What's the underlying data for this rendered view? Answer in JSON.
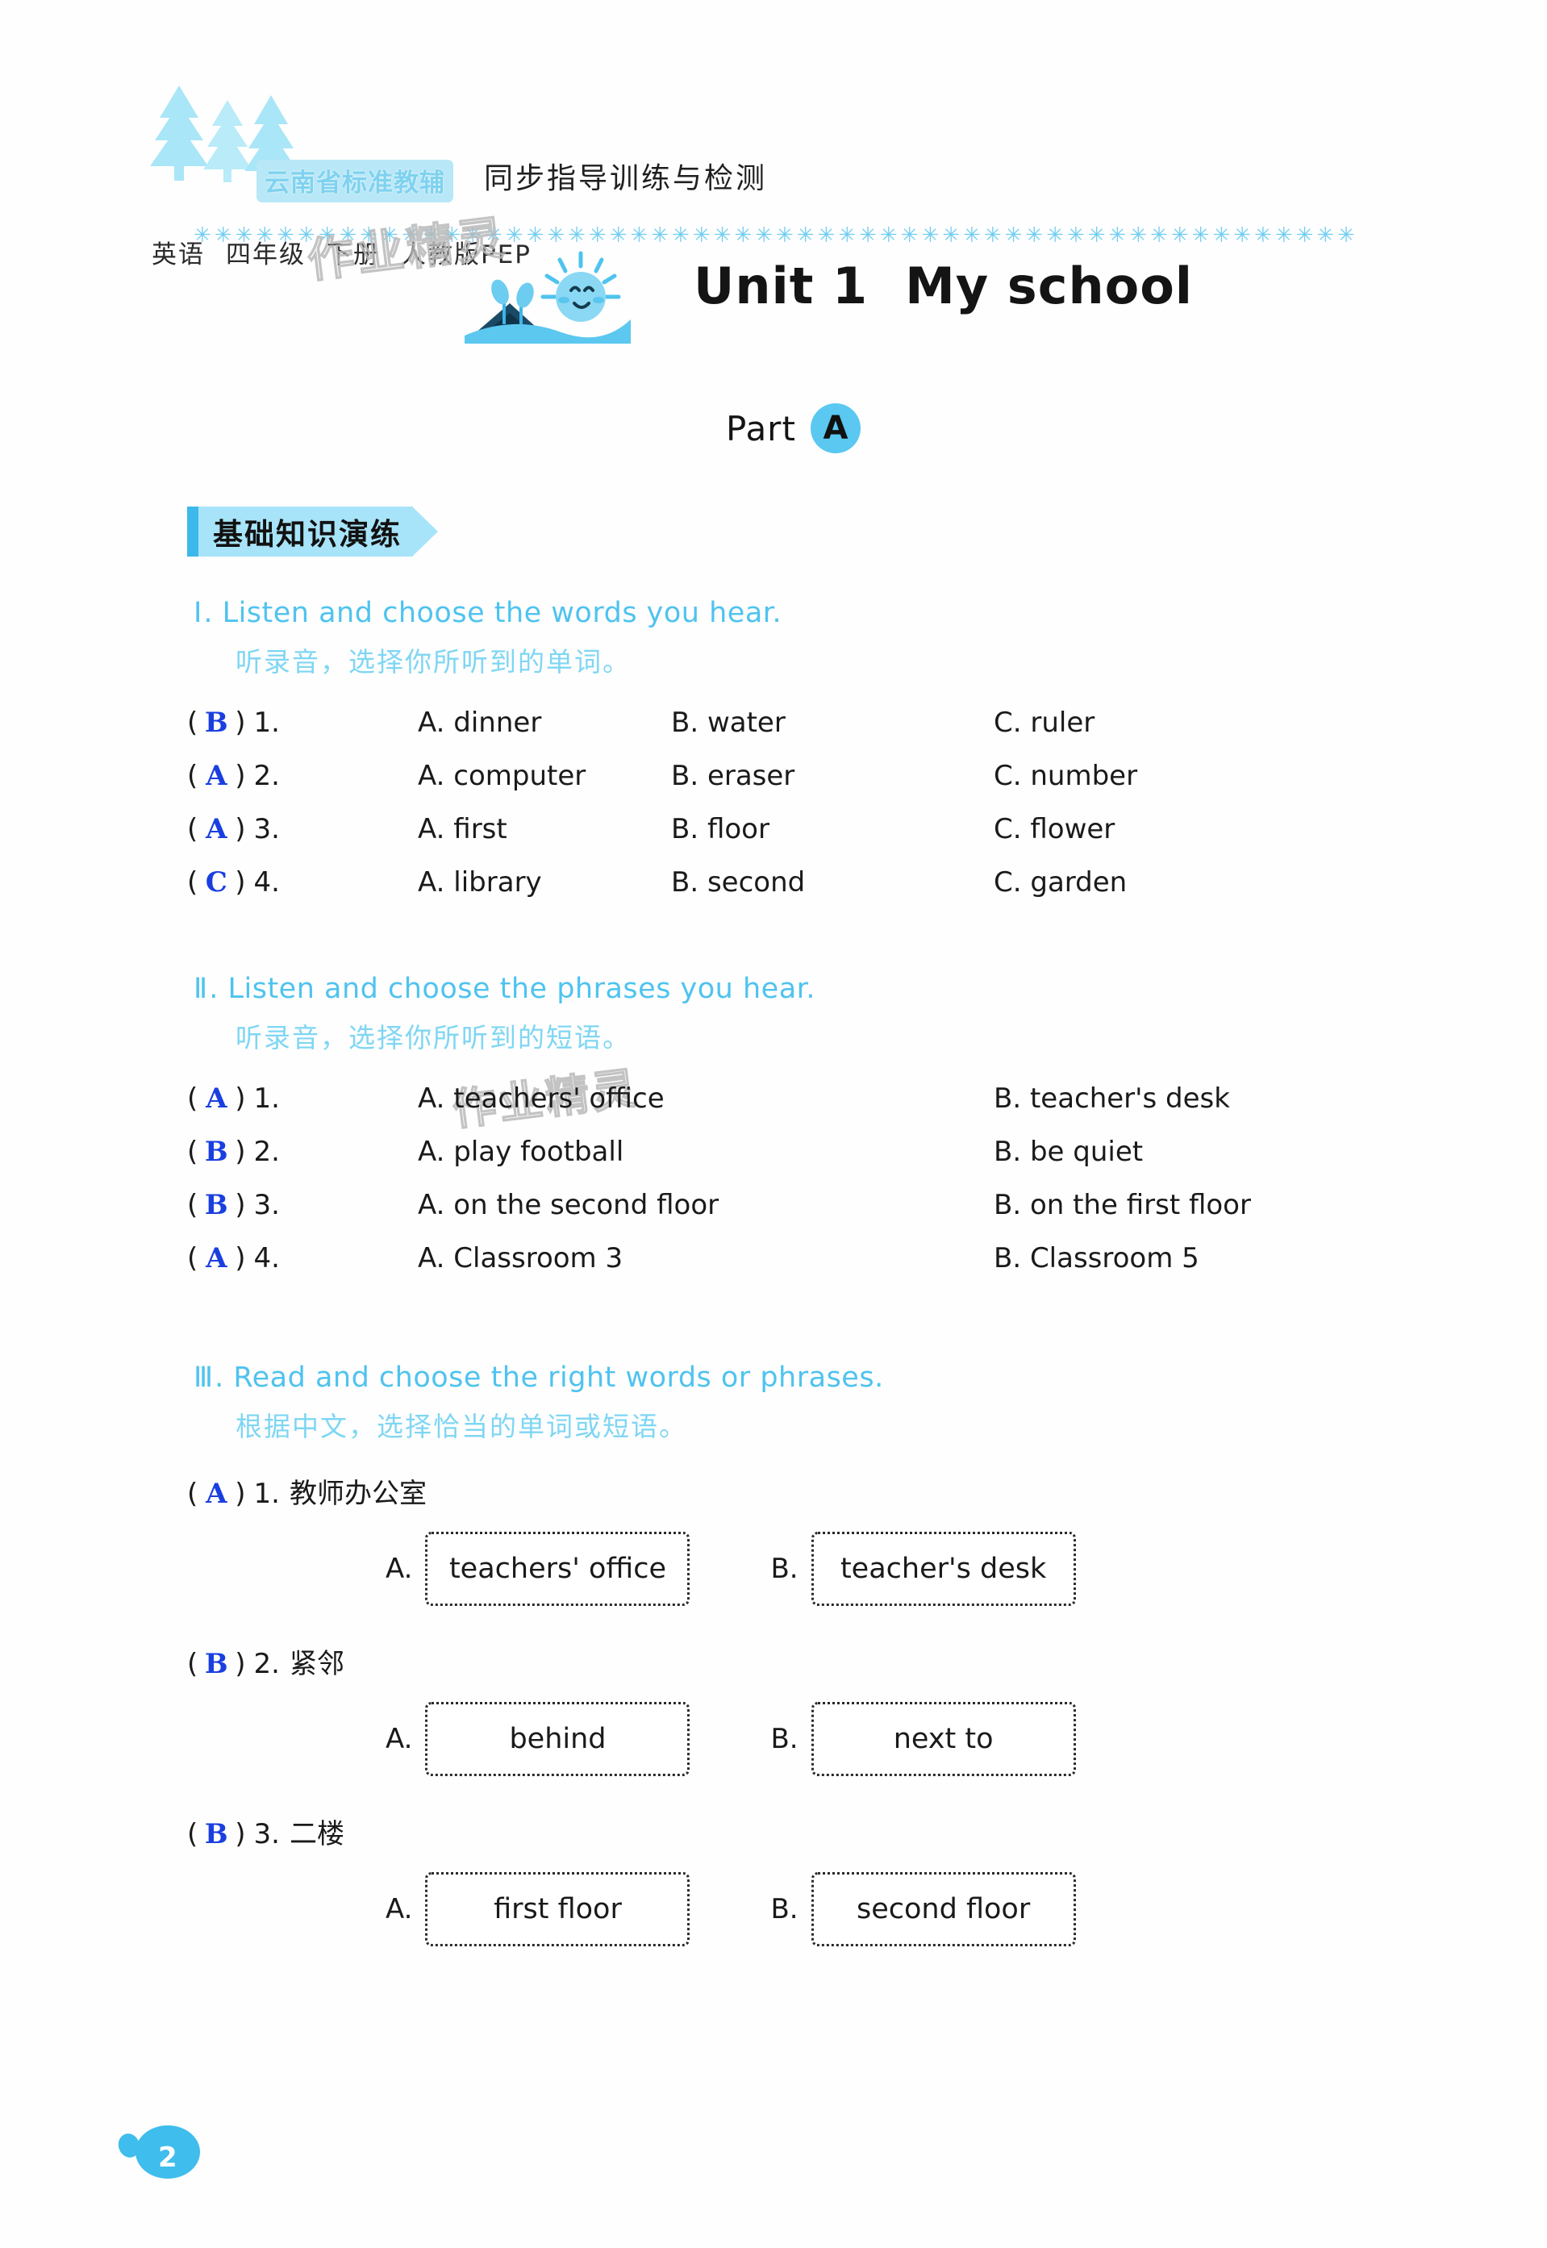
{
  "header": {
    "badge_title": "云南省标准教辅",
    "series_title": "同步指导训练与检测",
    "meta_subject": "英语",
    "meta_grade": "四年级",
    "meta_volume": "下册",
    "meta_edition": "人教版PEP",
    "divider_glyph": "✳",
    "accent_color": "#5ac8f0"
  },
  "watermark": {
    "text": "作业精灵"
  },
  "unit": {
    "title_prefix": "Unit 1",
    "title_name": "My school",
    "part_label": "Part",
    "part_letter": "A"
  },
  "section_banner": {
    "label": "基础知识演练"
  },
  "exercises": [
    {
      "roman": "Ⅰ",
      "title_en": ". Listen and choose the words you hear.",
      "title_cn": "听录音，选择你所听到的单词。",
      "type": "three-column",
      "items": [
        {
          "answer": "B",
          "num": "1.",
          "a": "A. dinner",
          "b": "B. water",
          "c": "C. ruler"
        },
        {
          "answer": "A",
          "num": "2.",
          "a": "A. computer",
          "b": "B. eraser",
          "c": "C. number"
        },
        {
          "answer": "A",
          "num": "3.",
          "a": "A. first",
          "b": "B. floor",
          "c": "C. flower"
        },
        {
          "answer": "C",
          "num": "4.",
          "a": "A. library",
          "b": "B. second",
          "c": "C. garden"
        }
      ]
    },
    {
      "roman": "Ⅱ",
      "title_en": ". Listen and choose the phrases you hear.",
      "title_cn": "听录音，选择你所听到的短语。",
      "type": "two-column",
      "items": [
        {
          "answer": "A",
          "num": "1.",
          "a": "A. teachers' office",
          "b": "B. teacher's desk"
        },
        {
          "answer": "B",
          "num": "2.",
          "a": "A. play football",
          "b": "B. be quiet"
        },
        {
          "answer": "B",
          "num": "3.",
          "a": "A. on the second floor",
          "b": "B. on the first floor"
        },
        {
          "answer": "A",
          "num": "4.",
          "a": "A. Classroom 3",
          "b": "B. Classroom 5"
        }
      ]
    },
    {
      "roman": "Ⅲ",
      "title_en": ". Read and choose the right words or phrases.",
      "title_cn": "根据中文，选择恰当的单词或短语。",
      "type": "boxed",
      "items": [
        {
          "answer": "A",
          "num": "1.",
          "stem": "教师办公室",
          "letter_a": "A.",
          "box_a": "teachers' office",
          "letter_b": "B.",
          "box_b": "teacher's desk"
        },
        {
          "answer": "B",
          "num": "2.",
          "stem": "紧邻",
          "letter_a": "A.",
          "box_a": "behind",
          "letter_b": "B.",
          "box_b": "next to"
        },
        {
          "answer": "B",
          "num": "3.",
          "stem": "二楼",
          "letter_a": "A.",
          "box_a": "first floor",
          "letter_b": "B.",
          "box_b": "second floor"
        }
      ]
    }
  ],
  "footer": {
    "page_number": "2"
  }
}
